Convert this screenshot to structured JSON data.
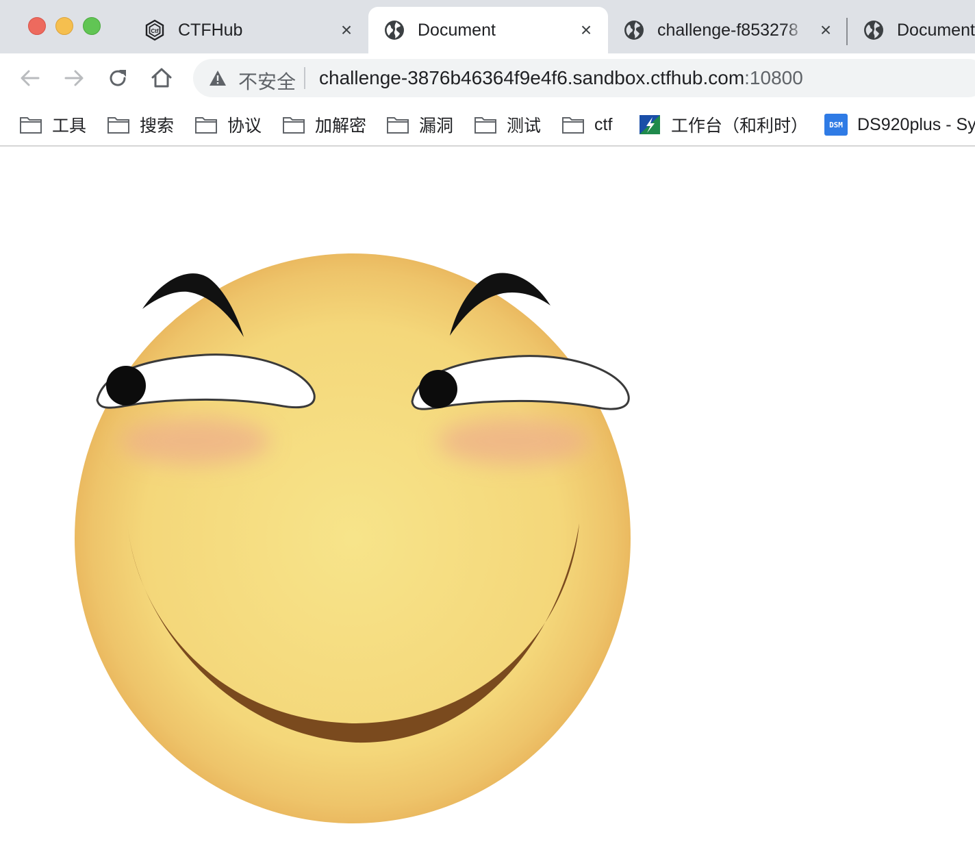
{
  "window": {
    "traffic_lights": [
      "close",
      "minimize",
      "maximize"
    ]
  },
  "tabs": [
    {
      "title": "CTFHub",
      "icon": "ctfhub-logo-icon",
      "active": false
    },
    {
      "title": "Document",
      "icon": "globe-icon",
      "active": true
    },
    {
      "title": "challenge-f853278",
      "icon": "globe-icon",
      "active": false
    },
    {
      "title": "Document",
      "icon": "globe-icon",
      "active": false
    }
  ],
  "toolbar": {
    "back_icon": "arrow-left-icon",
    "forward_icon": "arrow-right-icon",
    "reload_icon": "reload-icon",
    "home_icon": "home-icon"
  },
  "omnibox": {
    "security_label": "不安全",
    "security_icon": "warning-icon",
    "url_host": "challenge-3876b46364f9e4f6.sandbox.ctfhub.com",
    "url_port": ":10800"
  },
  "bookmarks": [
    {
      "label": "工具",
      "icon": "folder-icon"
    },
    {
      "label": "搜索",
      "icon": "folder-icon"
    },
    {
      "label": "协议",
      "icon": "folder-icon"
    },
    {
      "label": "加解密",
      "icon": "folder-icon"
    },
    {
      "label": "漏洞",
      "icon": "folder-icon"
    },
    {
      "label": "测试",
      "icon": "folder-icon"
    },
    {
      "label": "ctf",
      "icon": "folder-icon"
    },
    {
      "label": "工作台（和利时）",
      "icon": "workbench-logo-icon"
    },
    {
      "label": "DS920plus - Sy",
      "icon": "dsm-icon",
      "icon_text": "DSM"
    }
  ],
  "content": {
    "image": "smiling-emoji-face",
    "colors": {
      "face_light": "#f7e48a",
      "face_edge": "#e8b35a",
      "blush": "#eeae8a",
      "mouth": "#7a4a1e",
      "brow": "#111111"
    }
  }
}
